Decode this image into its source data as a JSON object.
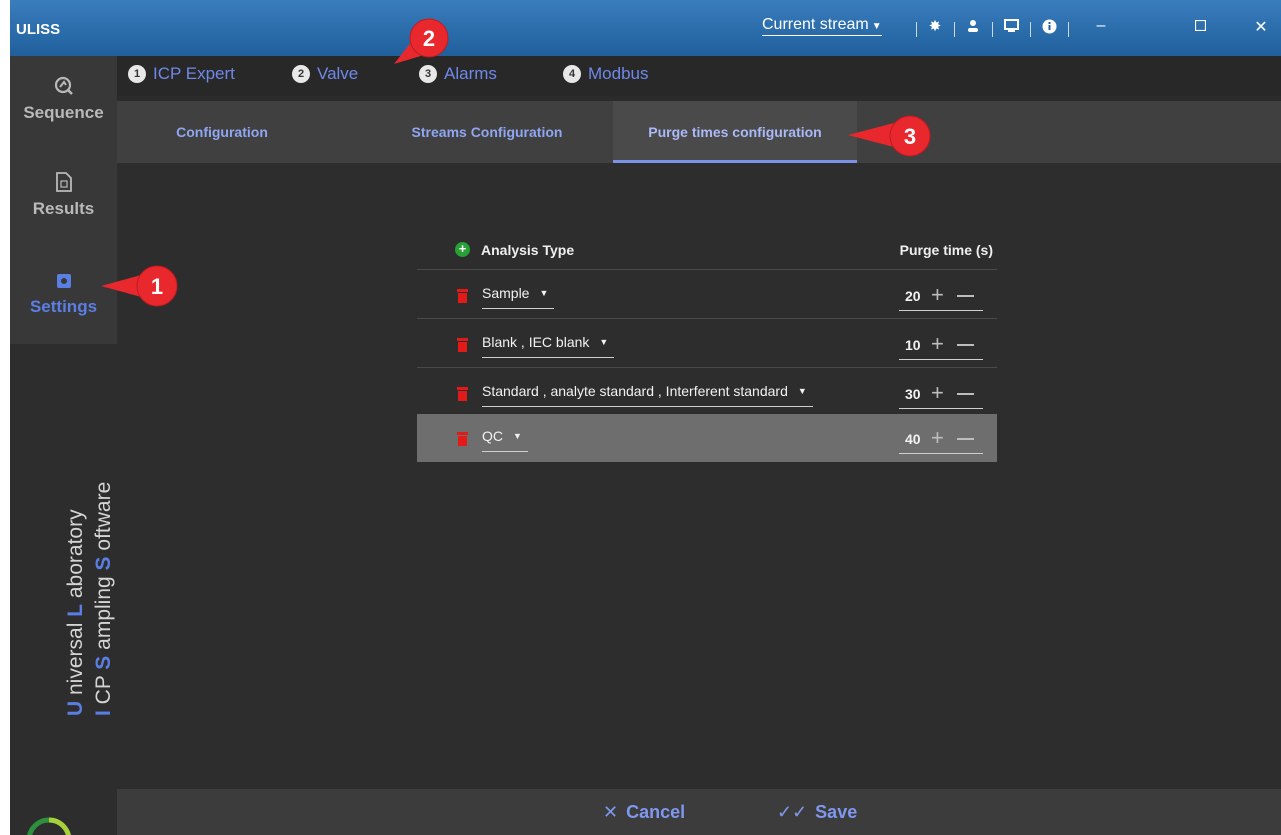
{
  "app": {
    "title": "ULISS"
  },
  "titlebar": {
    "current_stream": "Current stream",
    "icons": [
      "gear-icon",
      "user-icon",
      "screen-icon",
      "info-icon"
    ],
    "window_controls": [
      "minimize",
      "maximize",
      "close"
    ]
  },
  "rail": {
    "items": [
      {
        "label": "Sequence",
        "icon": "sequence-icon"
      },
      {
        "label": "Results",
        "icon": "document-icon"
      },
      {
        "label": "Settings",
        "icon": "settings-icon",
        "active": true
      }
    ],
    "brand": {
      "line1_a": "U",
      "line1_b": " niversal  ",
      "line1_c": "L",
      "line1_d": " aboratory",
      "line2_a": "I",
      "line2_b": " CP  ",
      "line2_c": "S",
      "line2_d": " ampling  ",
      "line2_e": "S",
      "line2_f": " oftware"
    }
  },
  "step_tabs": [
    {
      "num": "1",
      "label": "ICP Expert"
    },
    {
      "num": "2",
      "label": "Valve"
    },
    {
      "num": "3",
      "label": "Alarms"
    },
    {
      "num": "4",
      "label": "Modbus"
    }
  ],
  "sub_tabs": [
    {
      "label": "Configuration"
    },
    {
      "label": "Streams Configuration"
    },
    {
      "label": "Purge times configuration",
      "active": true
    }
  ],
  "purge_table": {
    "col_type": "Analysis Type",
    "col_purge": "Purge time (s)",
    "rows": [
      {
        "type": "Sample",
        "purge": "20"
      },
      {
        "type": "Blank , IEC blank",
        "purge": "10"
      },
      {
        "type": "Standard , analyte standard , Interferent standard",
        "purge": "30"
      },
      {
        "type": "QC",
        "purge": "40",
        "selected": true
      }
    ]
  },
  "footer": {
    "cancel": "Cancel",
    "save": "Save"
  },
  "callouts": [
    "1",
    "2",
    "3"
  ],
  "colors": {
    "accent": "#6f89e8",
    "callout": "#e8282d",
    "titlebar": "#2a6dad",
    "delete": "#e21a1a",
    "add": "#27a035"
  }
}
